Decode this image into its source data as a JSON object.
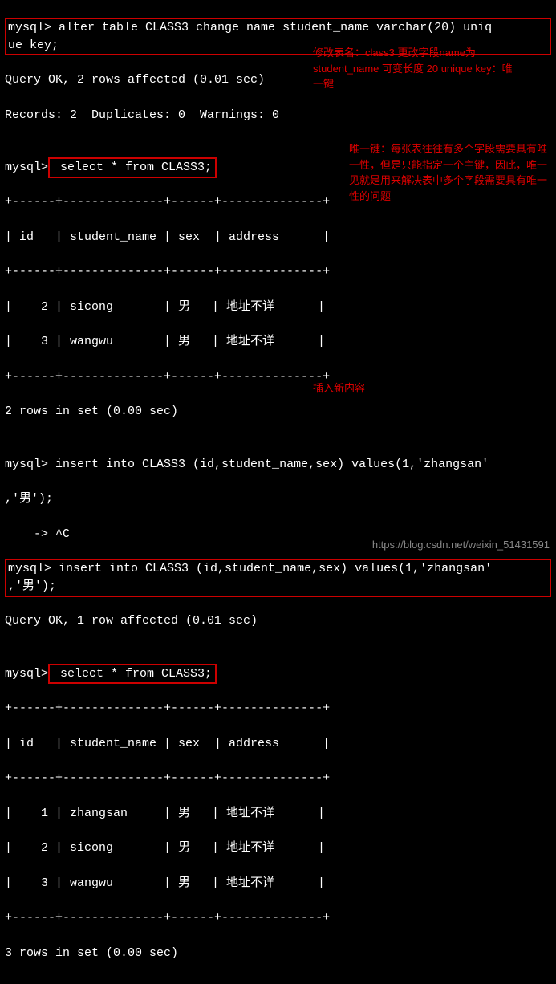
{
  "prompt": "mysql>",
  "cont": "    ->",
  "cmd1a": " alter table CLASS3 change name student_name varchar(20) uniq",
  "cmd1b": "ue key;",
  "res1a": "Query OK, 2 rows affected (0.01 sec)",
  "res1b": "Records: 2  Duplicates: 0  Warnings: 0",
  "cmd2": " select * from CLASS3;",
  "tbl_border": "+------+--------------+------+--------------+",
  "tbl_hdr": "| id   | student_name | sex  | address      |",
  "tbl1_r1": "|    2 | sicong       | 男   | 地址不详      |",
  "tbl1_r2": "|    3 | wangwu       | 男   | 地址不详      |",
  "res2": "2 rows in set (0.00 sec)",
  "cmd3a": " insert into CLASS3 (id,student_name,sex) values(1,'zhangsan'",
  "cmd3b": ",'男');",
  "cmd3c": " ^C",
  "cmd4a": " insert into CLASS3 (id,student_name,sex) values(1,'zhangsan'",
  "cmd4b": ",'男');",
  "res3": "Query OK, 1 row affected (0.01 sec)",
  "cmd5": " select * from CLASS3;",
  "tbl2_r1": "|    1 | zhangsan     | 男   | 地址不详      |",
  "tbl2_r2": "|    2 | sicong       | 男   | 地址不详      |",
  "tbl2_r3": "|    3 | wangwu       | 男   | 地址不详      |",
  "res4": "3 rows in set (0.00 sec)",
  "note1": "修改表名：class3 更改字段name为student_name 可变长度 20 unique key：唯一键",
  "note2": "唯一键：每张表往往有多个字段需要具有唯一性，但是只能指定一个主键，因此，唯一见就是用来解决表中多个字段需要具有唯一性的问题",
  "note3": "插入新内容",
  "watermark": "https://blog.csdn.net/weixin_51431591"
}
